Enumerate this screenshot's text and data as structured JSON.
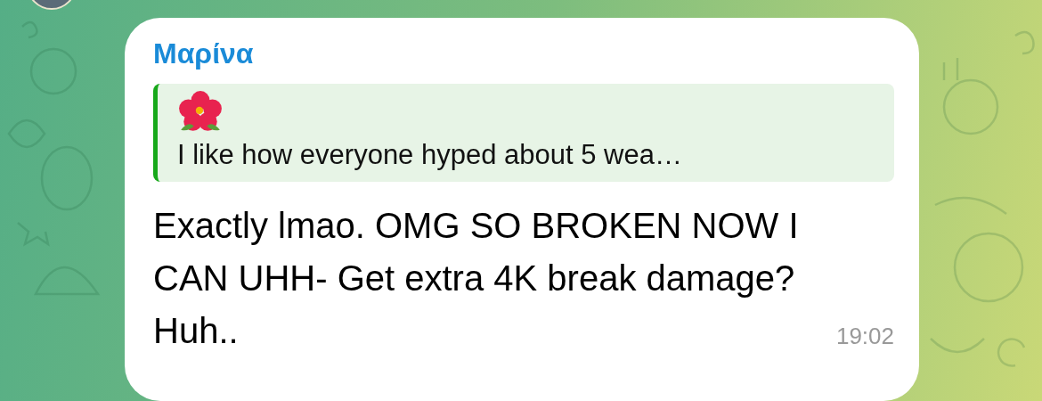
{
  "message": {
    "sender": "Μαρίνα",
    "reply": {
      "text": "I like how everyone hyped about 5 wea…"
    },
    "text": "Exactly lmao. OMG SO BROKEN NOW I CAN UHH- Get extra 4K break damage? Huh..",
    "time": "19:02"
  }
}
